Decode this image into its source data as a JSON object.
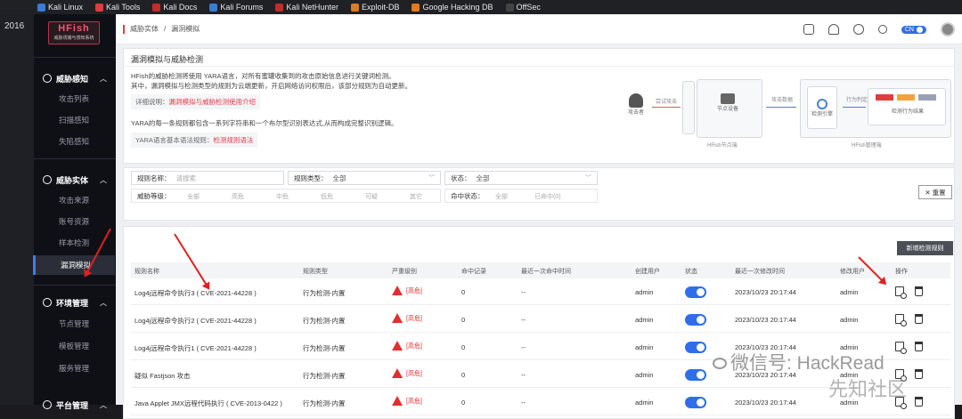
{
  "bookmarks": [
    {
      "label": "Kali Linux",
      "color": "#3a7bd5"
    },
    {
      "label": "Kali Tools",
      "color": "#e03c3c"
    },
    {
      "label": "Kali Docs",
      "color": "#c52b2b"
    },
    {
      "label": "Kali Forums",
      "color": "#3a7bd5"
    },
    {
      "label": "Kali NetHunter",
      "color": "#c52b2b"
    },
    {
      "label": "Exploit-DB",
      "color": "#e07b20"
    },
    {
      "label": "Google Hacking DB",
      "color": "#e07b20"
    },
    {
      "label": "OffSec",
      "color": "#444"
    }
  ],
  "frame_left": {
    "text": "2016"
  },
  "app": {
    "logo_title": "HFish",
    "logo_subtitle": "威胁诱捕与感知系统"
  },
  "sidebar": {
    "groups": [
      {
        "label": "威胁感知",
        "items": [
          "攻击列表",
          "扫描感知",
          "失陷感知"
        ]
      },
      {
        "label": "威胁实体",
        "items": [
          "攻击来源",
          "账号资源",
          "样本检测",
          "漏洞模拟"
        ]
      },
      {
        "label": "环境管理",
        "items": [
          "节点管理",
          "模板管理",
          "服务管理"
        ]
      },
      {
        "label": "平台管理",
        "items": []
      }
    ],
    "active_item": "漏洞模拟"
  },
  "topbar": {
    "breadcrumb": [
      "威胁实体",
      "漏洞模拟"
    ],
    "lang": "CN"
  },
  "intro": {
    "title": "漏洞模拟与威胁检测",
    "p1": "HFish的威胁检测将使用 YARA语言，对所有蜜罐收集到的攻击原始信息进行关键词检测。",
    "p2": "其中，漏洞模拟与检测类型的规则为云端更新，开启网络访问权限后，该部分规则为自动更新。",
    "tag1_label": "详细说明：",
    "tag1_link": "漏洞模拟与威胁检测使用介绍",
    "p3": "YARA的每一条规则都包含一系列字符串和一个布尔型识别表达式,从而构成完整识别逻辑。",
    "tag2_label": "YARA语言基本语法规则：",
    "tag2_link": "检测规则语法",
    "flow": {
      "attacker": "攻击者",
      "send_label": "尝试攻击",
      "node_device": "节点设备",
      "node_group": "HFish节点端",
      "collect_label": "攻击数据",
      "engine": "检测引擎",
      "result_label": "行为判定",
      "result_box": "检测行为结果",
      "mgmt": "HFish管理端"
    }
  },
  "filters": {
    "rule_name_label": "规则名称：",
    "rule_name_placeholder": "请搜索",
    "rule_type_label": "规则类型：",
    "rule_type_value": "全部",
    "status_label": "状态：",
    "status_value": "全部",
    "level_label": "威胁等级：",
    "levels": [
      "全部",
      "高危",
      "中危",
      "低危",
      "可疑",
      "其它"
    ],
    "hit_label": "命中状态：",
    "hit_values": [
      "全部",
      "已命中(0)"
    ],
    "reset": "重置"
  },
  "table": {
    "new_button": "新增检测规则",
    "columns": [
      "规则名称",
      "规则类型",
      "严重级别",
      "命中记录",
      "最近一次命中时间",
      "创建用户",
      "状态",
      "最近一次修改时间",
      "修改用户",
      "操作"
    ],
    "rows": [
      {
        "name": "Log4j远程命令执行3 ( CVE-2021-44228 )",
        "type": "行为检测-内置",
        "severity": "[高危]",
        "hits": "0",
        "last_hit": "--",
        "creator": "admin",
        "modified": "2023/10/23 20:17:44",
        "modifier": "admin"
      },
      {
        "name": "Log4j远程命令执行2 ( CVE-2021-44228 )",
        "type": "行为检测-内置",
        "severity": "[高危]",
        "hits": "0",
        "last_hit": "--",
        "creator": "admin",
        "modified": "2023/10/23 20:17:44",
        "modifier": "admin"
      },
      {
        "name": "Log4j远程命令执行1 ( CVE-2021-44228 )",
        "type": "行为检测-内置",
        "severity": "[高危]",
        "hits": "0",
        "last_hit": "--",
        "creator": "admin",
        "modified": "2023/10/23 20:17:44",
        "modifier": "admin"
      },
      {
        "name": "疑似 Fastjson 攻击",
        "type": "行为检测-内置",
        "severity": "[高危]",
        "hits": "0",
        "last_hit": "--",
        "creator": "admin",
        "modified": "2023/10/23 20:17:44",
        "modifier": "admin"
      },
      {
        "name": "Java Applet JMX远程代码执行 ( CVE-2013-0422 )",
        "type": "行为检测-内置",
        "severity": "[高危]",
        "hits": "0",
        "last_hit": "--",
        "creator": "admin",
        "modified": "2023/10/23 20:17:44",
        "modifier": "admin"
      }
    ]
  },
  "watermark": {
    "line1": "微信号: HackRead",
    "line2": "先知社区"
  },
  "colors": {
    "accent": "#2f6ee8",
    "danger": "#e02f2f",
    "sidebar": "#0f1016"
  }
}
